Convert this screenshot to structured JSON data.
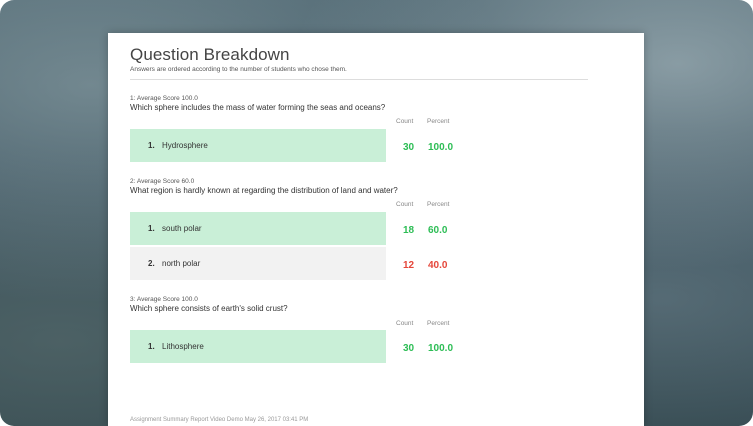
{
  "report": {
    "title": "Question Breakdown",
    "subtitle": "Answers are ordered according to the number of students who chose them.",
    "count_header": "Count",
    "percent_header": "Percent",
    "footer": "Assignment Summary Report Video Demo May 26, 2017 03:41 PM"
  },
  "questions": [
    {
      "meta": "1: Average Score 100.0",
      "text": "Which sphere includes the mass of water forming the seas and oceans?",
      "answers": [
        {
          "num": "1.",
          "label": "Hydrosphere",
          "count": "30",
          "percent": "100.0",
          "correct": true
        }
      ]
    },
    {
      "meta": "2: Average Score 60.0",
      "text": "What region is hardly known at regarding the distribution of land and water?",
      "answers": [
        {
          "num": "1.",
          "label": "south polar",
          "count": "18",
          "percent": "60.0",
          "correct": true
        },
        {
          "num": "2.",
          "label": "north polar",
          "count": "12",
          "percent": "40.0",
          "correct": false
        }
      ]
    },
    {
      "meta": "3: Average Score 100.0",
      "text": "Which sphere consists of earth's solid crust?",
      "answers": [
        {
          "num": "1.",
          "label": "Lithosphere",
          "count": "30",
          "percent": "100.0",
          "correct": true
        }
      ]
    }
  ],
  "colors": {
    "correct_bg": "#c9efd7",
    "wrong_bg": "#f2f2f2",
    "correct_text": "#2dbd55",
    "wrong_text": "#e5463a"
  }
}
